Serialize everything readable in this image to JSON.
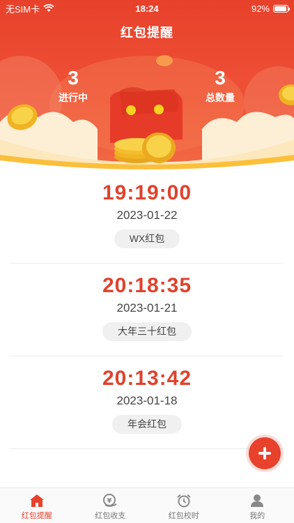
{
  "status_bar": {
    "carrier": "无SIM卡",
    "time": "18:24",
    "battery": "92%",
    "battery_level": 0.92
  },
  "header": {
    "title": "红包提醒",
    "stats": [
      {
        "value": "3",
        "label": "进行中"
      },
      {
        "value": "3",
        "label": "总数量"
      }
    ]
  },
  "reminders": [
    {
      "time": "19:19:00",
      "date": "2023-01-22",
      "tag": "WX红包"
    },
    {
      "time": "20:18:35",
      "date": "2023-01-21",
      "tag": "大年三十红包"
    },
    {
      "time": "20:13:42",
      "date": "2023-01-18",
      "tag": "年会红包"
    }
  ],
  "tabbar": {
    "tabs": [
      {
        "label": "红包提醒",
        "icon": "home-icon",
        "active": true
      },
      {
        "label": "红包收支",
        "icon": "wallet-icon",
        "active": false
      },
      {
        "label": "红包校时",
        "icon": "alarm-clock-icon",
        "active": false
      },
      {
        "label": "我的",
        "icon": "user-icon",
        "active": false
      }
    ]
  },
  "colors": {
    "primary": "#e8422d",
    "time_text": "#e0422d",
    "tab_active": "#e8422d",
    "tab_inactive": "#888888"
  }
}
